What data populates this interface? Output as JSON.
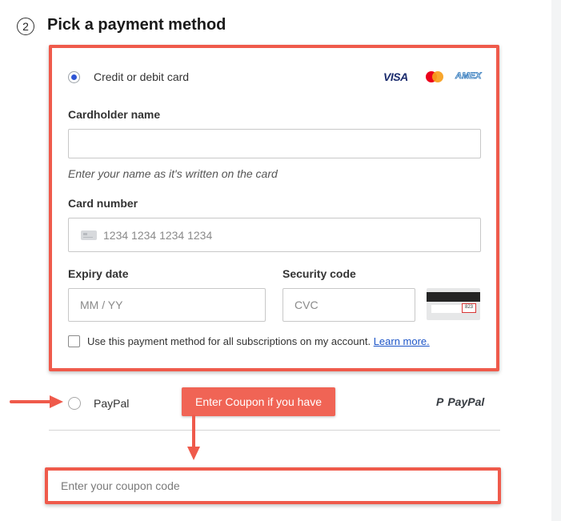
{
  "step": {
    "number": "2",
    "title": "Pick a payment method"
  },
  "card_method": {
    "label": "Credit or debit card",
    "selected": true,
    "brands": {
      "visa": "VISA",
      "amex": "AMEX"
    },
    "cardholder": {
      "label": "Cardholder name",
      "value": "",
      "placeholder": "",
      "hint": "Enter your name as it's written on the card"
    },
    "card_number": {
      "label": "Card number",
      "placeholder": "1234 1234 1234 1234"
    },
    "expiry": {
      "label": "Expiry date",
      "placeholder": "MM / YY"
    },
    "security": {
      "label": "Security code",
      "placeholder": "CVC",
      "graphic_code": "823"
    },
    "save_for_all": {
      "label": "Use this payment method for all subscriptions on my account.",
      "link": "Learn more.",
      "checked": false
    }
  },
  "paypal_method": {
    "label": "PayPal",
    "logo_text": "PayPal",
    "selected": false
  },
  "annotation": {
    "callout": "Enter Coupon if you have"
  },
  "coupon": {
    "placeholder": "Enter your coupon code",
    "value": ""
  },
  "colors": {
    "highlight": "#ef5a4b",
    "radio_selected": "#2f55d4",
    "link": "#1e56c8"
  }
}
